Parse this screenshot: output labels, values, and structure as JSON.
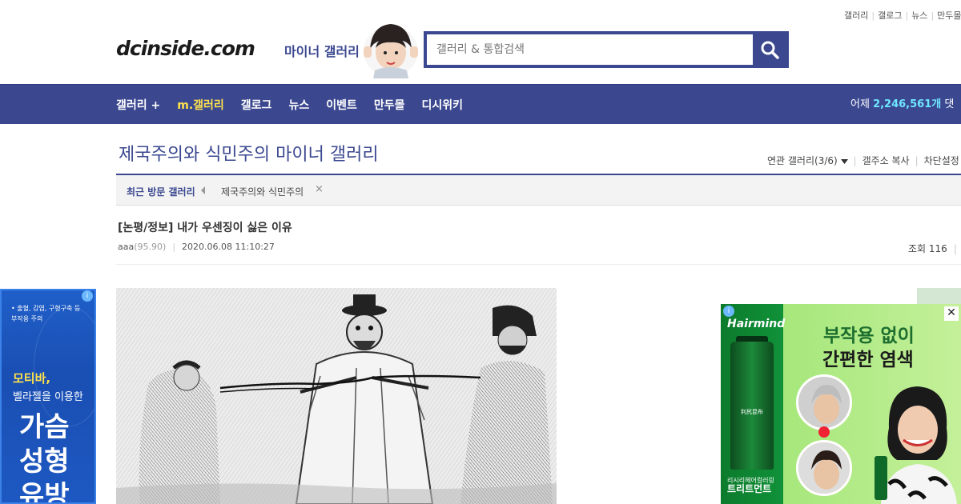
{
  "top_links": [
    "갤러리",
    "갤로그",
    "뉴스",
    "만두몰"
  ],
  "logo": {
    "text": "dcinside.com",
    "sub": "마이너 갤러리"
  },
  "search": {
    "placeholder": "갤러리 & 통합검색"
  },
  "nav": {
    "items": [
      "갤러리 +",
      "m.갤러리",
      "갤로그",
      "뉴스",
      "이벤트",
      "만두몰",
      "디시위키"
    ],
    "yesterday_label": "어제",
    "yesterday_count": "2,246,561개",
    "yesterday_suffix": "댓"
  },
  "gallery": {
    "title": "제국주의와 식민주의 마이너 갤러리",
    "tools": [
      "연관 갤러리(3/6)",
      "갤주소 복사",
      "차단설정"
    ]
  },
  "recent": {
    "label": "최근 방문 갤러리",
    "item": "제국주의와 식민주의",
    "close": "×"
  },
  "post": {
    "title": "[논평/정보] 내가 우센징이 싫은 이유",
    "author": "aaa",
    "author_score": "(95.90)",
    "date": "2020.06.08 11:10:27",
    "views": "조회 116"
  },
  "ad_left": {
    "info": "i",
    "warning_line1": "• 출혈, 감염, 구형구축 등",
    "warning_line2": "부작용 주의",
    "brand": "모티바,",
    "brand_sub": "벨라젤을 이용한",
    "big_line1": "가슴",
    "big_line2": "성형",
    "big_line3": "유방"
  },
  "ad_right": {
    "info": "i",
    "brand": "Hairmind",
    "headline1": "부작용 없이",
    "headline2": "간편한 염색",
    "bottle_label": "利尻昆布",
    "product_line1": "리시리헤어컬러링",
    "product_line2": "트리트먼트"
  },
  "colors": {
    "brand": "#3b4890",
    "nav_active": "#ffe24d",
    "count": "#6ee6ff"
  }
}
